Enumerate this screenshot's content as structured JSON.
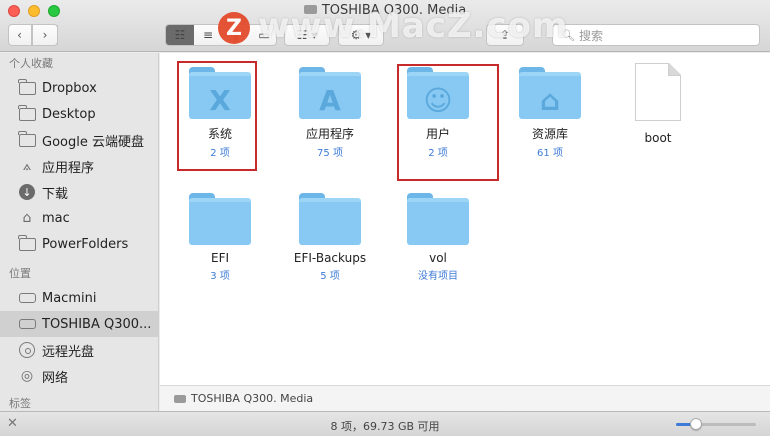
{
  "window": {
    "title": "TOSHIBA Q300. Media",
    "watermark": "www.MacZ.com",
    "watermark_logo": "Z"
  },
  "toolbar": {
    "back_icon": "chevron-left-icon",
    "forward_icon": "chevron-right-icon",
    "view_modes": [
      "icon-view",
      "list-view",
      "column-view",
      "gallery-view"
    ],
    "search_placeholder": "搜索"
  },
  "sidebar": {
    "favorites_header": "个人收藏",
    "favorites": [
      {
        "label": "Dropbox",
        "icon": "folder-icon"
      },
      {
        "label": "Desktop",
        "icon": "folder-icon"
      },
      {
        "label": "Google 云端硬盘",
        "icon": "folder-icon"
      },
      {
        "label": "应用程序",
        "icon": "applications-icon"
      },
      {
        "label": "下载",
        "icon": "download-icon"
      },
      {
        "label": "mac",
        "icon": "home-icon"
      },
      {
        "label": "PowerFolders",
        "icon": "folder-icon"
      }
    ],
    "locations_header": "位置",
    "locations": [
      {
        "label": "Macmini",
        "icon": "drive-icon"
      },
      {
        "label": "TOSHIBA Q300...",
        "icon": "drive-icon",
        "selected": true
      },
      {
        "label": "远程光盘",
        "icon": "disc-icon"
      },
      {
        "label": "网络",
        "icon": "network-icon"
      }
    ],
    "tags_header": "标签"
  },
  "items": [
    {
      "name": "系统",
      "sub": "2 项",
      "kind": "folder",
      "emblem": "X"
    },
    {
      "name": "应用程序",
      "sub": "75 项",
      "kind": "folder",
      "emblem": "A"
    },
    {
      "name": "用户",
      "sub": "2 项",
      "kind": "folder",
      "emblem": "user"
    },
    {
      "name": "资源库",
      "sub": "61 项",
      "kind": "folder",
      "emblem": "library"
    },
    {
      "name": "boot",
      "sub": "",
      "kind": "file"
    },
    {
      "name": "EFI",
      "sub": "3 项",
      "kind": "folder"
    },
    {
      "name": "EFI-Backups",
      "sub": "5 项",
      "kind": "folder"
    },
    {
      "name": "vol",
      "sub": "没有项目",
      "kind": "folder"
    }
  ],
  "highlighted_items": [
    "系统",
    "用户"
  ],
  "pathbar": {
    "label": "TOSHIBA Q300. Media"
  },
  "statusbar": {
    "text": "8 项，69.73 GB 可用",
    "icon_size_level": 0.25
  },
  "colors": {
    "folder": "#87c9f3",
    "highlight": "#c62a2a",
    "accent": "#3d7bd6"
  }
}
